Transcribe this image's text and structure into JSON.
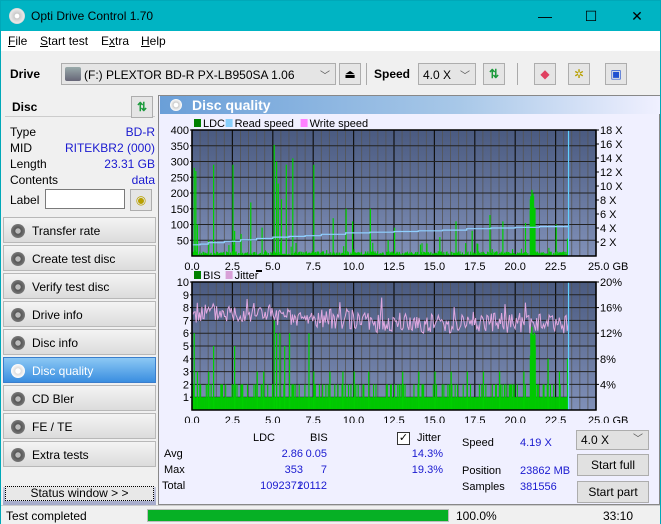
{
  "window": {
    "title": "Opti Drive Control 1.70",
    "minimize_glyph": "—",
    "maximize_glyph": "☐",
    "close_glyph": "✕"
  },
  "menu": [
    "File",
    "Start test",
    "Extra",
    "Help"
  ],
  "menu_underline": [
    "F",
    "S",
    "x",
    "H"
  ],
  "toolbar": {
    "drive_label": "Drive",
    "drive_value": "(F:)  PLEXTOR BD-R  PX-LB950SA 1.06",
    "speed_label": "Speed",
    "speed_value": "4.0 X",
    "icons": [
      "eject-icon",
      "refresh-icon",
      "eraser-icon",
      "settings-icon",
      "save-icon"
    ]
  },
  "disc": {
    "header": "Disc",
    "rows": [
      {
        "key": "Type",
        "value": "BD-R"
      },
      {
        "key": "MID",
        "value": "RITEKBR2 (000)"
      },
      {
        "key": "Length",
        "value": "23.31 GB"
      },
      {
        "key": "Contents",
        "value": "data"
      }
    ],
    "label_key": "Label",
    "label_value": ""
  },
  "nav": [
    {
      "label": "Transfer rate",
      "active": false
    },
    {
      "label": "Create test disc",
      "active": false
    },
    {
      "label": "Verify test disc",
      "active": false
    },
    {
      "label": "Drive info",
      "active": false
    },
    {
      "label": "Disc info",
      "active": false
    },
    {
      "label": "Disc quality",
      "active": true
    },
    {
      "label": "CD Bler",
      "active": false
    },
    {
      "label": "FE / TE",
      "active": false
    },
    {
      "label": "Extra tests",
      "active": false
    }
  ],
  "status_window_button": "Status window > >",
  "panel_title": "Disc quality",
  "chart_data": [
    {
      "type": "bar",
      "title": "LDC / Read speed",
      "legend": [
        {
          "name": "LDC",
          "color": "#008000"
        },
        {
          "name": "Read speed",
          "color": "#87cefa"
        },
        {
          "name": "Write speed",
          "color": "#ff80ff"
        }
      ],
      "x_ticks": [
        "0.0",
        "2.5",
        "5.0",
        "7.5",
        "10.0",
        "12.5",
        "15.0",
        "17.5",
        "20.0",
        "22.5",
        "25.0 GB"
      ],
      "xlim": [
        0,
        25
      ],
      "y_left_ticks": [
        "50",
        "100",
        "150",
        "200",
        "250",
        "300",
        "350",
        "400"
      ],
      "ylim_left": [
        0,
        400
      ],
      "y_right_ticks": [
        "2 X",
        "4 X",
        "6 X",
        "8 X",
        "10 X",
        "12 X",
        "14 X",
        "16 X",
        "18 X"
      ],
      "ylim_right": [
        0,
        18
      ],
      "ldc_spikes": [
        [
          0.1,
          280
        ],
        [
          0.2,
          270
        ],
        [
          0.3,
          100
        ],
        [
          1.0,
          50
        ],
        [
          1.3,
          290
        ],
        [
          2.5,
          290
        ],
        [
          2.6,
          80
        ],
        [
          3.0,
          70
        ],
        [
          3.6,
          170
        ],
        [
          4.3,
          90
        ],
        [
          5.05,
          353
        ],
        [
          5.2,
          300
        ],
        [
          5.3,
          230
        ],
        [
          5.5,
          180
        ],
        [
          5.8,
          290
        ],
        [
          6.2,
          310
        ],
        [
          7.5,
          290
        ],
        [
          8.7,
          120
        ],
        [
          9.5,
          150
        ],
        [
          9.9,
          110
        ],
        [
          11.0,
          150
        ],
        [
          12.1,
          50
        ],
        [
          12.5,
          90
        ],
        [
          14.5,
          40
        ],
        [
          15.3,
          60
        ],
        [
          16.3,
          110
        ],
        [
          17.3,
          80
        ],
        [
          17.6,
          40
        ],
        [
          18.4,
          130
        ],
        [
          19.2,
          110
        ],
        [
          20.6,
          105
        ],
        [
          20.9,
          180
        ],
        [
          21.0,
          210
        ],
        [
          21.1,
          190
        ],
        [
          22.5,
          100
        ],
        [
          23.2,
          55
        ]
      ],
      "read_speed": [
        [
          0,
          1.6
        ],
        [
          0.5,
          1.7
        ],
        [
          1.0,
          1.9
        ],
        [
          2.0,
          2.1
        ],
        [
          3.0,
          2.3
        ],
        [
          4.0,
          2.5
        ],
        [
          5.0,
          2.7
        ],
        [
          6.0,
          2.8
        ],
        [
          7.0,
          2.9
        ],
        [
          8.0,
          3.1
        ],
        [
          9.5,
          3.3
        ],
        [
          11.0,
          3.4
        ],
        [
          12.5,
          3.5
        ],
        [
          14.0,
          3.6
        ],
        [
          15.5,
          3.7
        ],
        [
          17.0,
          3.9
        ],
        [
          18.5,
          4.0
        ],
        [
          20.0,
          4.1
        ],
        [
          21.5,
          4.2
        ],
        [
          23.3,
          4.25
        ]
      ],
      "end_marker_gb": 23.3
    },
    {
      "type": "bar",
      "title": "BIS / Jitter",
      "legend": [
        {
          "name": "BIS",
          "color": "#008000"
        },
        {
          "name": "Jitter",
          "color": "#d8a0d8"
        }
      ],
      "x_ticks": [
        "0.0",
        "2.5",
        "5.0",
        "7.5",
        "10.0",
        "12.5",
        "15.0",
        "17.5",
        "20.0",
        "22.5",
        "25.0 GB"
      ],
      "xlim": [
        0,
        25
      ],
      "y_left_ticks": [
        "1",
        "2",
        "3",
        "4",
        "5",
        "6",
        "7",
        "8",
        "9",
        "10"
      ],
      "ylim_left": [
        0,
        10
      ],
      "y_right_ticks": [
        "4%",
        "8%",
        "12%",
        "16%",
        "20%"
      ],
      "ylim_right": [
        0,
        20
      ],
      "bis_spikes": [
        [
          0.1,
          6
        ],
        [
          0.3,
          3
        ],
        [
          1.0,
          3
        ],
        [
          1.3,
          5
        ],
        [
          2.6,
          5
        ],
        [
          3.1,
          2
        ],
        [
          4.0,
          3
        ],
        [
          4.4,
          3
        ],
        [
          5.05,
          7
        ],
        [
          5.2,
          6
        ],
        [
          5.4,
          6
        ],
        [
          5.7,
          5
        ],
        [
          6.0,
          6
        ],
        [
          7.2,
          6
        ],
        [
          7.5,
          3
        ],
        [
          8.5,
          3
        ],
        [
          9.3,
          3
        ],
        [
          10.0,
          3
        ],
        [
          10.9,
          3
        ],
        [
          13.0,
          3
        ],
        [
          14.0,
          3
        ],
        [
          15.0,
          3
        ],
        [
          16.0,
          3
        ],
        [
          17.0,
          3
        ],
        [
          18.0,
          3
        ],
        [
          19.0,
          3
        ],
        [
          20.5,
          3
        ],
        [
          21.0,
          6.5
        ],
        [
          21.2,
          5
        ],
        [
          22.0,
          4
        ],
        [
          22.7,
          3
        ],
        [
          23.2,
          4
        ]
      ],
      "jitter_avg_pct": 14.3,
      "jitter_max_pct": 19.3,
      "end_marker_gb": 23.3
    }
  ],
  "stats": {
    "col_ldc": "LDC",
    "col_bis": "BIS",
    "jitter_label": "Jitter",
    "jitter_checked": true,
    "rows": [
      {
        "label": "Avg",
        "ldc": "2.86",
        "bis": "0.05",
        "jitter": "14.3%"
      },
      {
        "label": "Max",
        "ldc": "353",
        "bis": "7",
        "jitter": "19.3%"
      },
      {
        "label": "Total",
        "ldc": "1092371",
        "bis": "20112",
        "jitter": ""
      }
    ],
    "speed_label": "Speed",
    "speed_value": "4.19 X",
    "position_label": "Position",
    "position_value": "23862 MB",
    "samples_label": "Samples",
    "samples_value": "381556",
    "speed_select": "4.0 X",
    "start_full": "Start full",
    "start_part": "Start part"
  },
  "statusbar": {
    "text": "Test completed",
    "progress_pct": 100,
    "progress_text": "100.0%",
    "time": "33:10"
  }
}
